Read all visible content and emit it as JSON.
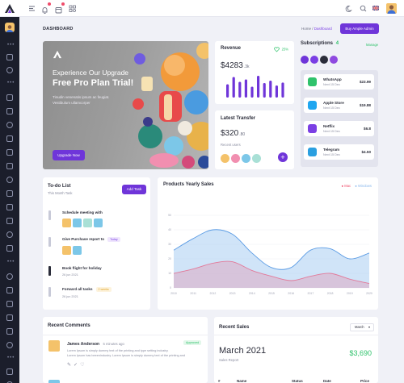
{
  "topbar": {
    "icons": [
      "logo-icon",
      "menu-icon",
      "bell-icon",
      "calendar-icon",
      "apps-icon",
      "moon-icon",
      "search-icon",
      "flag-icon",
      "user-avatar"
    ]
  },
  "page": {
    "title": "DASHBOARD",
    "breadcrumb": [
      "Home",
      "Dashboard"
    ],
    "cta_label": "Buy Ample Admin"
  },
  "hero": {
    "title_line1": "Experience Our Upgrade",
    "title_line2": "Free Pro Plan Trial!",
    "text_line1": "Tinudin venenatis ipsum ac feugiat.",
    "text_line2": "Vestibulum ullamcorper",
    "button_label": "Upgrade Now"
  },
  "revenue": {
    "title": "Revenue",
    "growth": "25%",
    "amount": "$4283",
    "unit": ".3k",
    "bars": [
      0.55,
      0.85,
      0.65,
      0.75,
      0.45,
      0.9,
      0.6,
      0.7,
      0.5,
      0.62
    ]
  },
  "transfer": {
    "title": "Latest Transfer",
    "amount": "$320",
    "unit": ".80",
    "recent_label": "Recent users",
    "add_label": "+"
  },
  "subscriptions": {
    "title": "Subscriptions",
    "count": "4",
    "manage_label": "Manage",
    "items": [
      {
        "name": "WhatsApp",
        "next": "Next 15 Dec",
        "price": "$23.99",
        "color": "#2fc26b"
      },
      {
        "name": "Apple Store",
        "next": "Next 15 Dec",
        "price": "$19.88",
        "color": "#1fa6f0"
      },
      {
        "name": "Netflix",
        "next": "Next 15 Dec",
        "price": "$6.8",
        "color": "#7b3fe4"
      },
      {
        "name": "Telegram",
        "next": "Next 15 Dec",
        "price": "$4.50",
        "color": "#2a9fe0"
      }
    ]
  },
  "todo": {
    "title": "To-do List",
    "subtitle": "This Month Task",
    "add_label": "Add Task",
    "items": [
      {
        "text": "Schedule meeting with",
        "date": "",
        "tag": "",
        "check_color": "#c8cad8"
      },
      {
        "text": "Give Purchase report to",
        "date": "",
        "tag": "Today",
        "check_color": "#c8cad8"
      },
      {
        "text": "Book flight for holiday",
        "date": "26 jun 2021",
        "tag": "",
        "check_color": "#2b2d3a"
      },
      {
        "text": "Forward all tasks",
        "date": "26 jun 2021",
        "tag": "2 weeks",
        "check_color": "#c8cad8"
      }
    ]
  },
  "chart_data": {
    "type": "area",
    "title": "Products Yearly Sales",
    "x": [
      "2010",
      "2011",
      "2012",
      "2013",
      "2014",
      "2015",
      "2016",
      "2017",
      "2018",
      "2019",
      "2020"
    ],
    "series": [
      {
        "name": "Mac",
        "color": "#e58aa6",
        "values": [
          10,
          13,
          17,
          18,
          12,
          8,
          5,
          8,
          10,
          6,
          3
        ]
      },
      {
        "name": "Windows",
        "color": "#a9cdf3",
        "values": [
          26,
          34,
          40,
          37,
          24,
          14,
          14,
          26,
          27,
          20,
          24
        ]
      }
    ],
    "y_ticks": [
      "0",
      "10",
      "20",
      "30",
      "40",
      "50"
    ],
    "ylim": [
      0,
      50
    ],
    "grid": true,
    "legend_position": "top-right"
  },
  "comments": {
    "title": "Recent Comments",
    "items": [
      {
        "name": "James Anderson",
        "time": "5 minutes ago",
        "text_line1": "Lorem Ipsum is simply dummy text of the printing and type setting industry.",
        "text_line2": "Lorem Ipsum has beeenindustry. Lorem Ipsum is simply dummy text of the printing and",
        "status": "Approved"
      }
    ]
  },
  "sales": {
    "title": "Recent Sales",
    "period": "March",
    "month": "March 2021",
    "sub": "Sales Report",
    "amount": "$3,690",
    "columns": [
      "#",
      "Name",
      "Status",
      "Date",
      "Price"
    ]
  }
}
